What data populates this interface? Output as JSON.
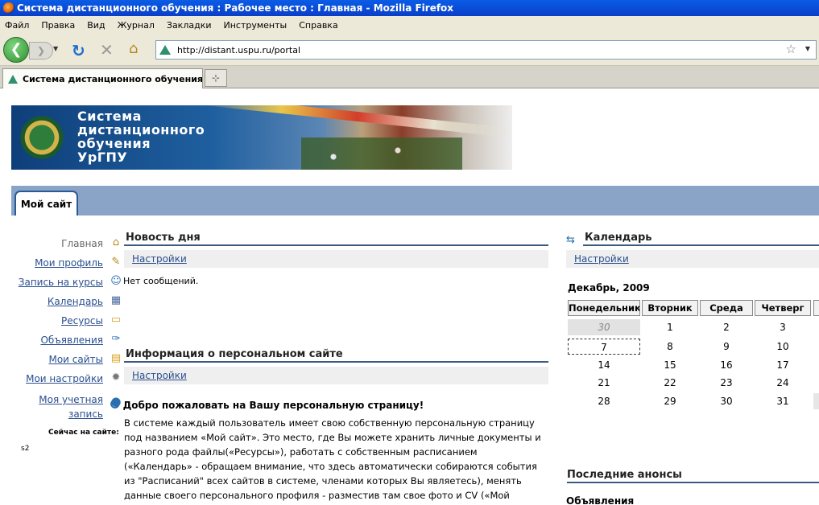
{
  "window": {
    "title": "Система дистанционного обучения : Рабочее место : Главная - Mozilla Firefox"
  },
  "menu": [
    "Файл",
    "Правка",
    "Вид",
    "Журнал",
    "Закладки",
    "Инструменты",
    "Справка"
  ],
  "browser": {
    "url": "http://distant.uspu.ru/portal",
    "tab_title": "Система дистанционного обучения...",
    "newtab_glyph": "⊹"
  },
  "banner": {
    "title_line1": "Система",
    "title_line2": "дистанционного",
    "title_line3": "обучения",
    "title_line4": "УрГПУ"
  },
  "site_tab": "Мой сайт",
  "sidebar": {
    "items": [
      {
        "label": "Главная",
        "icon": "home-icon",
        "glyph": "⌂",
        "current": true
      },
      {
        "label": "Мои профиль",
        "icon": "profile-icon",
        "glyph": "✎"
      },
      {
        "label": "Запись на курсы",
        "icon": "user-icon",
        "glyph": "☺"
      },
      {
        "label": "Календарь",
        "icon": "calendar-icon",
        "glyph": "▦"
      },
      {
        "label": "Ресурсы",
        "icon": "folder-icon",
        "glyph": "▭"
      },
      {
        "label": "Объявления",
        "icon": "pin-icon",
        "glyph": "✑"
      },
      {
        "label": "Мои сайты",
        "icon": "sites-icon",
        "glyph": "▤"
      },
      {
        "label": "Мои настройки",
        "icon": "gear-icon",
        "glyph": "✹"
      },
      {
        "label": "Моя учетная запись",
        "icon": "account-icon",
        "glyph": "☻"
      }
    ],
    "online_label": "Сейчас на сайте:",
    "online_user": "s2"
  },
  "news": {
    "title": "Новость дня",
    "settings": "Настройки",
    "empty": "Нет сообщений."
  },
  "site_info": {
    "title": "Информация о персональном сайте",
    "settings": "Настройки",
    "welcome": "Добро пожаловать на Вашу персональную страницу!",
    "text": "В системе каждый пользователь имеет свою собственную персональную страницу под названием «Мой сайт». Это место, где Вы можете хранить личные документы и разного рода файлы(«Ресурсы»), работать с собственным расписанием («Календарь» - обращаем внимание, что здесь автоматически собираются события из \"Расписаний\" всех сайтов в системе, членами которых Вы являетесь), менять данные своего персонального профиля - разместив там свое фото и CV («Мой профиль»), менять"
  },
  "calendar": {
    "title": "Календарь",
    "settings": "Настройки",
    "month": "Декабрь, 2009",
    "headers": [
      "Понедельник",
      "Вторник",
      "Среда",
      "Четверг"
    ],
    "rows": [
      [
        "30",
        "1",
        "2",
        "3"
      ],
      [
        "7",
        "8",
        "9",
        "10"
      ],
      [
        "14",
        "15",
        "16",
        "17"
      ],
      [
        "21",
        "22",
        "23",
        "24"
      ],
      [
        "28",
        "29",
        "30",
        "31"
      ]
    ]
  },
  "announcements": {
    "title": "Последние анонсы",
    "subtitle": "Объявления"
  },
  "colors": {
    "accent": "#3c5a80",
    "tabstrip": "#8aa4c8",
    "link": "#2a4f8f"
  }
}
